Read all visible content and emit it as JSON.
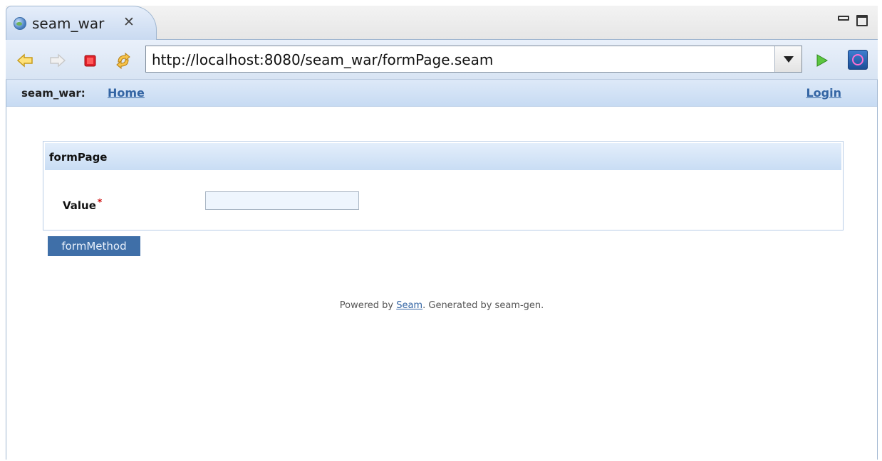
{
  "editor_tab": {
    "title": "seam_war",
    "icon": "globe-icon",
    "close_icon": "close-tab-icon"
  },
  "window_controls": {
    "minimize_icon": "minimize-icon",
    "maximize_icon": "maximize-icon"
  },
  "toolbar": {
    "back_icon": "back-arrow-icon",
    "forward_icon": "forward-arrow-icon",
    "stop_icon": "stop-icon",
    "refresh_icon": "refresh-icon",
    "url": "http://localhost:8080/seam_war/formPage.seam",
    "go_icon": "go-icon",
    "external_browser_icon": "external-browser-icon"
  },
  "navbar": {
    "brand": "seam_war:",
    "home": "Home",
    "login": "Login"
  },
  "form": {
    "title": "formPage",
    "field_label": "Value",
    "required_marker": "*",
    "field_value": "",
    "submit_label": "formMethod"
  },
  "footer": {
    "prefix": "Powered by ",
    "link": "Seam",
    "suffix": ". Generated by seam-gen."
  },
  "colors": {
    "accent": "#3465a4",
    "button": "#3f6fa8",
    "header_bg": "#c9ddf4"
  }
}
